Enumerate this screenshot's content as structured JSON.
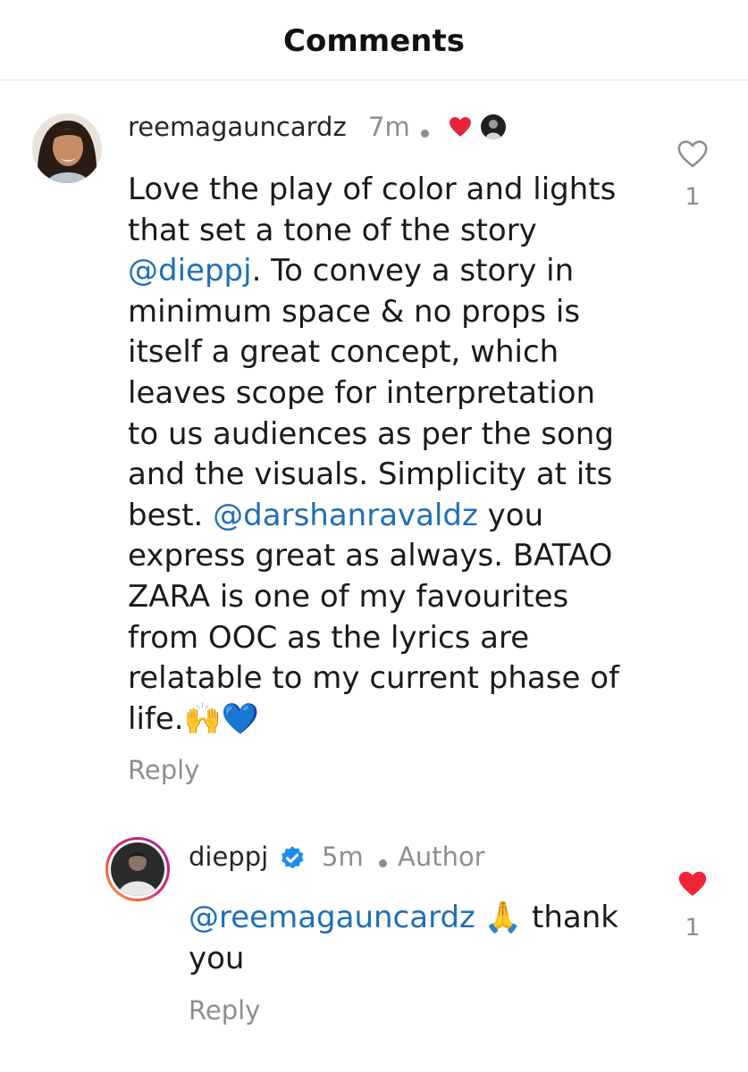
{
  "header": {
    "title": "Comments"
  },
  "comments": [
    {
      "username": "reemagauncardz",
      "time": "7m",
      "lines": [
        "Love the play of color and lights",
        "that set a tone of the story",
        ". To convey a story in",
        "minimum space & no props is",
        "itself a great concept, which",
        "leaves scope for interpretation",
        "to us audiences as per the song",
        "and the visuals. Simplicity at its",
        "best. ",
        " you",
        "express great as always. BATAO",
        "ZARA is one of my favourites",
        "from OOC as the lyrics are",
        "relatable to my current phase of",
        "life.🙌💙"
      ],
      "mentions": [
        "@dieppj",
        "@darshanravaldz"
      ],
      "reply_label": "Reply",
      "like_count": "1",
      "liked": false,
      "colors": {
        "creator_heart": "#e8243a"
      }
    }
  ],
  "replies": [
    {
      "username": "dieppj",
      "time": "5m",
      "author_label": "Author",
      "mention": "@reemagauncardz",
      "text_after_emoji": " thank",
      "line2": "you",
      "emoji": "🙏",
      "reply_label": "Reply",
      "like_count": "1",
      "liked": true,
      "colors": {
        "verified": "#1d8cf0",
        "liked_heart": "#ef2536"
      }
    }
  ]
}
